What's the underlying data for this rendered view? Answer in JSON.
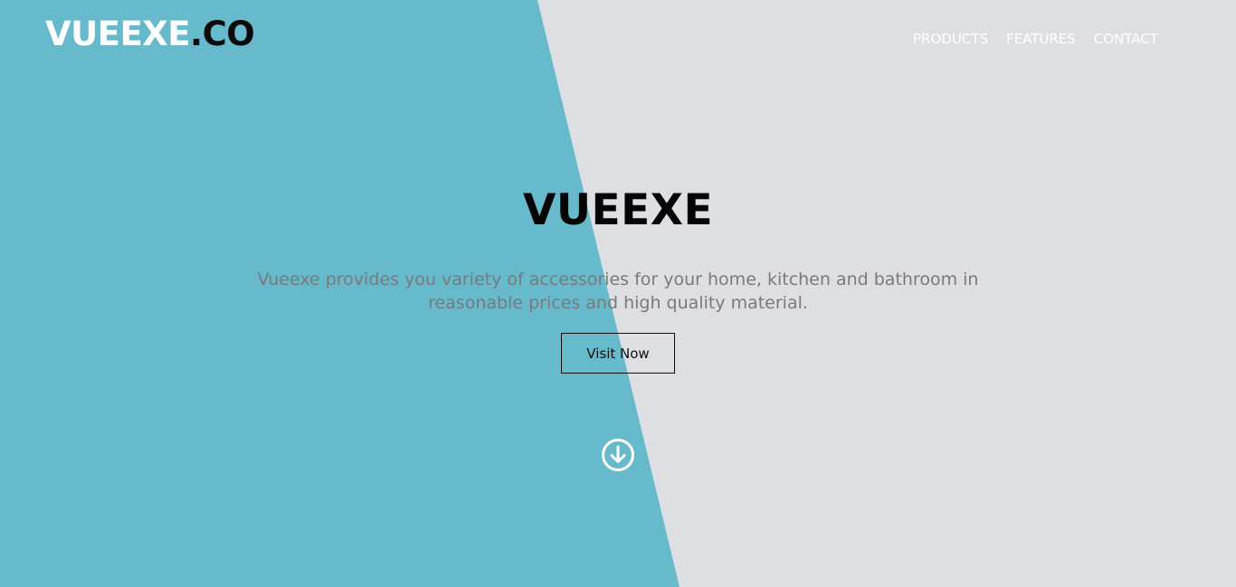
{
  "brand": {
    "logo_part1": "VUEEXE",
    "logo_part2": ".CO"
  },
  "nav": {
    "items": [
      {
        "label": "PRODUCTS"
      },
      {
        "label": "FEATURES"
      },
      {
        "label": "CONTACT"
      }
    ]
  },
  "hero": {
    "title": "VUEEXE",
    "description": "Vueexe provides you variety of accessories for your home, kitchen and bathroom in reasonable prices and high quality material.",
    "cta_label": "Visit Now",
    "scroll_icon": "arrow-down-circle-icon"
  },
  "colors": {
    "accent_teal": "#67b9cc",
    "background_gray": "#dedfe3",
    "text_dark": "#050505",
    "text_muted": "#7a7a7a"
  }
}
